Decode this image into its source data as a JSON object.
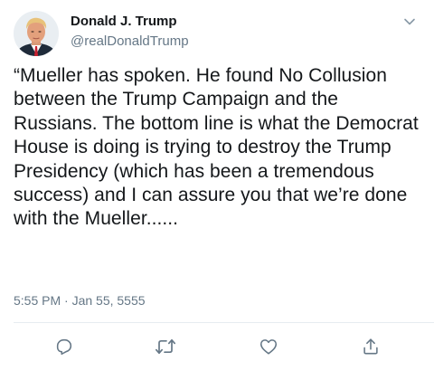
{
  "tweet": {
    "author": {
      "display_name": "Donald J. Trump",
      "handle": "@realDonaldTrump",
      "avatar_icon": "profile-photo"
    },
    "text": "“Mueller has spoken. He found No Collusion between the Trump Campaign and the Russians. The bottom line is what the Democrat House is doing is trying to destroy the Trump Presidency (which has been a tremendous success) and I can assure you that we’re done with the Mueller......",
    "timestamp": "5:55 PM · Jan 55, 5555",
    "menu_icon": "chevron-down-icon",
    "actions": [
      {
        "name": "reply",
        "icon": "reply-icon"
      },
      {
        "name": "retweet",
        "icon": "retweet-icon"
      },
      {
        "name": "like",
        "icon": "heart-icon"
      },
      {
        "name": "share",
        "icon": "share-icon"
      }
    ],
    "colors": {
      "text": "#14171a",
      "secondary": "#657786",
      "icon": "#657786",
      "divider": "#e6ecf0"
    }
  }
}
